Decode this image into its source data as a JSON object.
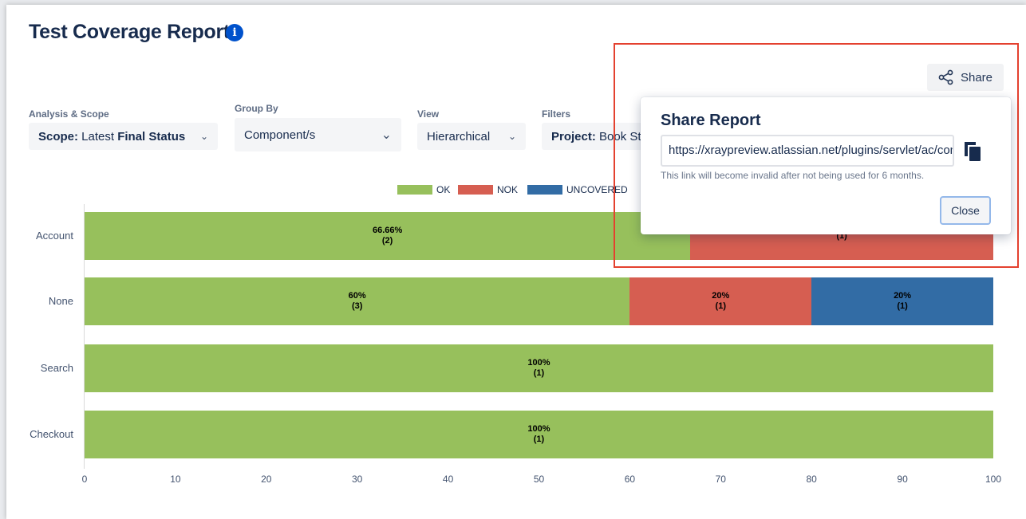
{
  "header": {
    "title": "Test Coverage Report",
    "info_icon": "info-icon"
  },
  "share": {
    "label": "Share",
    "icon": "share-icon"
  },
  "filters": {
    "analysis": {
      "label": "Analysis & Scope",
      "prefix": "Scope:",
      "middle": " Latest ",
      "bold": "Final Status"
    },
    "group_by": {
      "label": "Group By",
      "value": "Component/s"
    },
    "view": {
      "label": "View",
      "value": "Hierarchical"
    },
    "filters": {
      "label": "Filters",
      "prefix": "Project:",
      "value": " Book St"
    }
  },
  "legend": [
    {
      "label": "OK",
      "color": "#97c05c"
    },
    {
      "label": "NOK",
      "color": "#d65e51"
    },
    {
      "label": "UNCOVERED",
      "color": "#326ca5"
    }
  ],
  "chart_data": {
    "type": "bar",
    "orientation": "horizontal",
    "stacked": true,
    "categories": [
      "Account",
      "None",
      "Search",
      "Checkout"
    ],
    "series": [
      {
        "name": "OK",
        "color": "#97c05c",
        "values": [
          66.66,
          60,
          100,
          100
        ],
        "labels": [
          "66.66%",
          "60%",
          "100%",
          "100%"
        ],
        "counts": [
          "(2)",
          "(3)",
          "(1)",
          "(1)"
        ]
      },
      {
        "name": "NOK",
        "color": "#d65e51",
        "values": [
          33.33,
          20,
          0,
          0
        ],
        "labels": [
          "",
          "20%",
          "",
          ""
        ],
        "counts": [
          "(1)",
          "(1)",
          "",
          ""
        ]
      },
      {
        "name": "UNCOVERED",
        "color": "#326ca5",
        "values": [
          0,
          20,
          0,
          0
        ],
        "labels": [
          "",
          "20%",
          "",
          ""
        ],
        "counts": [
          "",
          "(1)",
          "",
          ""
        ]
      }
    ],
    "xlim": [
      0,
      100
    ],
    "xticks": [
      "0",
      "10",
      "20",
      "30",
      "40",
      "50",
      "60",
      "70",
      "80",
      "90",
      "100"
    ],
    "legend_position": "top-center"
  },
  "popup": {
    "title": "Share Report",
    "url": "https://xraypreview.atlassian.net/plugins/servlet/ac/com.xpandit.plugins.xray",
    "help": "This link will become invalid after not being used for 6 months.",
    "close": "Close",
    "copy_icon": "copy-icon"
  }
}
